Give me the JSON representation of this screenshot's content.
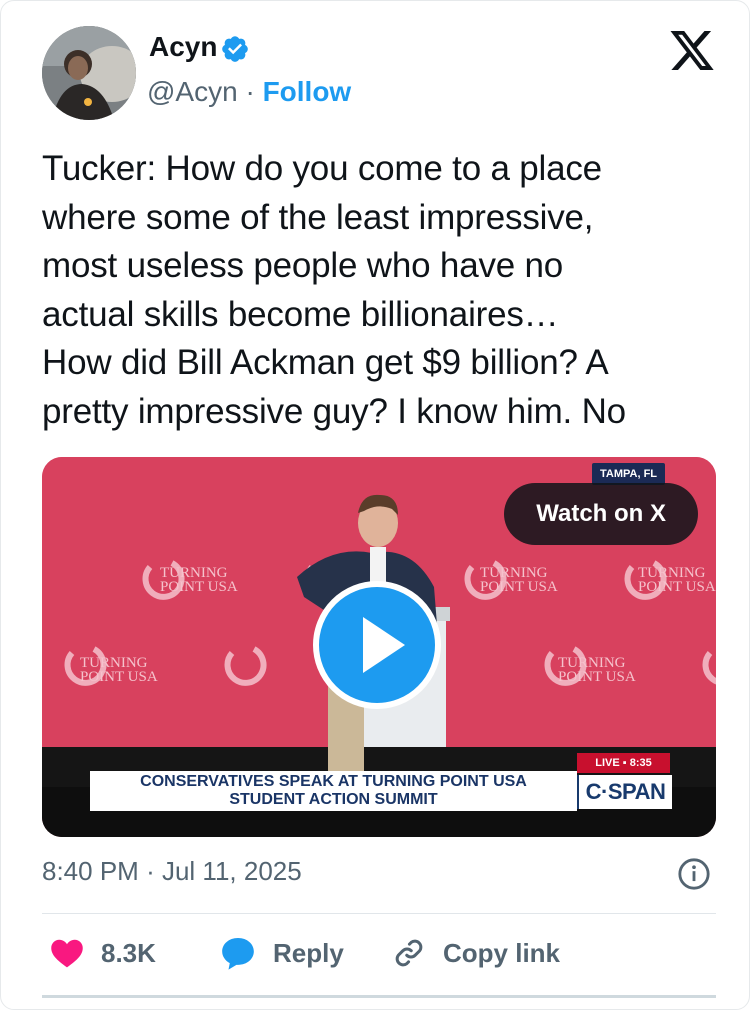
{
  "author": {
    "display_name": "Acyn",
    "handle": "@Acyn",
    "separator": "·",
    "follow_label": "Follow"
  },
  "tweet": {
    "text": "Tucker: How do you come to a place\nwhere some of the least impressive,\nmost useless people who have no\nactual skills become billionaires…\nHow did Bill Ackman get $9 billion? A\npretty impressive guy? I know him. No"
  },
  "media": {
    "watch_label": "Watch on X",
    "location_tag": "TAMPA, FL",
    "live_tag": "LIVE ▪ 8:35",
    "chyron_line1": "CONSERVATIVES SPEAK AT TURNING POINT USA",
    "chyron_line2": "STUDENT ACTION SUMMIT",
    "network_logo": "C·SPAN",
    "backdrop_logo_line1": "TURNING",
    "backdrop_logo_line2": "POINT USA"
  },
  "meta": {
    "time": "8:40 PM",
    "separator": "·",
    "date": "Jul 11, 2025"
  },
  "actions": {
    "like_count": "8.3K",
    "reply_label": "Reply",
    "copy_link_label": "Copy link"
  },
  "colors": {
    "accent": "#1d9bf0",
    "like": "#f91880",
    "text_primary": "#0f1419",
    "text_secondary": "#536471",
    "stage_backdrop": "#d8415e"
  },
  "icons": {
    "verified": "verified-badge-icon",
    "brand": "x-logo-icon",
    "play": "play-icon",
    "info": "info-icon",
    "like": "heart-icon",
    "reply": "speech-bubble-icon",
    "copy_link": "link-icon"
  }
}
